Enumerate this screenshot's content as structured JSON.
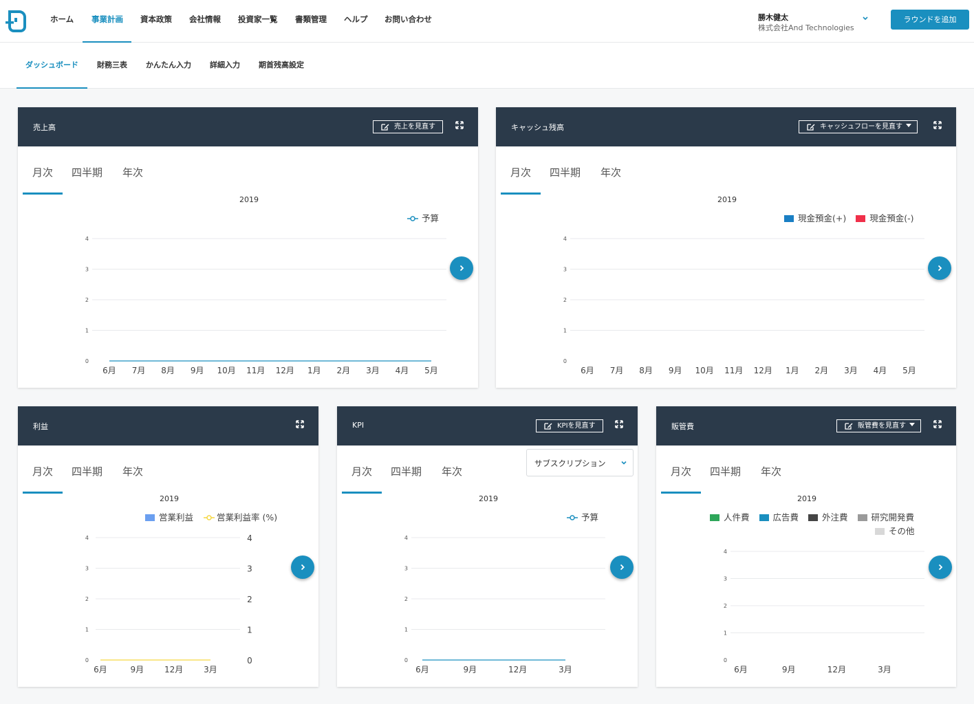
{
  "nav": {
    "items": [
      "ホーム",
      "事業計画",
      "資本政策",
      "会社情報",
      "投資家一覧",
      "書類管理",
      "ヘルプ",
      "お問い合わせ"
    ],
    "active_index": 1,
    "user_name": "勝木健太",
    "user_company": "株式会社And Technologies",
    "add_round_label": "ラウンドを追加"
  },
  "subnav": {
    "items": [
      "ダッシュボード",
      "財務三表",
      "かんたん入力",
      "詳細入力",
      "期首残高設定"
    ],
    "active_index": 0
  },
  "common": {
    "tabs": [
      "月次",
      "四半期",
      "年次"
    ],
    "year": "2019"
  },
  "cards": {
    "sales": {
      "title": "売上高",
      "revise_label": "売上を見直す"
    },
    "cash": {
      "title": "キャッシュ残高",
      "revise_label": "キャッシュフローを見直す"
    },
    "profit": {
      "title": "利益"
    },
    "kpi": {
      "title": "KPI",
      "revise_label": "KPIを見直す",
      "select_value": "サブスクリプション"
    },
    "sga": {
      "title": "販管費",
      "revise_label": "販管費を見直す"
    }
  },
  "colors": {
    "accent": "#1a8fbf",
    "header_bg": "#2b3a4a",
    "cash_plus": "#1a7fc4",
    "cash_minus": "#f0304a",
    "op_profit": "#6b9ff0",
    "op_margin": "#f5d742",
    "personnel": "#2ea65a",
    "advertising": "#1a8fbf",
    "outsourcing": "#454545",
    "rnd": "#9a9a9a",
    "other": "#d8d8d8"
  },
  "chart_data": [
    {
      "type": "line",
      "panel": "売上高",
      "title": "2019",
      "categories": [
        "6月",
        "7月",
        "8月",
        "9月",
        "10月",
        "11月",
        "12月",
        "1月",
        "2月",
        "3月",
        "4月",
        "5月"
      ],
      "series": [
        {
          "name": "予算",
          "values": [
            0,
            0,
            0,
            0,
            0,
            0,
            0,
            0,
            0,
            0,
            0,
            0
          ]
        }
      ],
      "y_ticks": [
        "0",
        "1",
        "2",
        "3",
        "4"
      ],
      "ylim": [
        0,
        4
      ],
      "grid": true,
      "legend": "top-right"
    },
    {
      "type": "bar",
      "panel": "キャッシュ残高",
      "title": "2019",
      "categories": [
        "6月",
        "7月",
        "8月",
        "9月",
        "10月",
        "11月",
        "12月",
        "1月",
        "2月",
        "3月",
        "4月",
        "5月"
      ],
      "series": [
        {
          "name": "現金預金(+)",
          "values": [
            0,
            0,
            0,
            0,
            0,
            0,
            0,
            0,
            0,
            0,
            0,
            0
          ]
        },
        {
          "name": "現金預金(-)",
          "values": [
            0,
            0,
            0,
            0,
            0,
            0,
            0,
            0,
            0,
            0,
            0,
            0
          ]
        }
      ],
      "y_ticks": [
        "0",
        "1",
        "2",
        "3",
        "4"
      ],
      "ylim": [
        0,
        4
      ],
      "grid": true,
      "legend": "top-right"
    },
    {
      "type": "bar",
      "panel": "利益",
      "title": "2019",
      "categories": [
        "6月",
        "9月",
        "12月",
        "3月"
      ],
      "series": [
        {
          "name": "営業利益",
          "values": [
            0,
            0,
            0,
            0
          ]
        },
        {
          "name": "営業利益率 (%)",
          "values": [
            0,
            0,
            0,
            0
          ]
        }
      ],
      "y_ticks": [
        "0",
        "1",
        "2",
        "3",
        "4"
      ],
      "y2_ticks": [
        "0",
        "1",
        "2",
        "3",
        "4"
      ],
      "ylim": [
        0,
        4
      ],
      "grid": true,
      "legend": "top-right"
    },
    {
      "type": "line",
      "panel": "KPI",
      "title": "2019",
      "categories": [
        "6月",
        "9月",
        "12月",
        "3月"
      ],
      "series": [
        {
          "name": "予算",
          "values": [
            0,
            0,
            0,
            0
          ]
        }
      ],
      "y_ticks": [
        "0",
        "1",
        "2",
        "3",
        "4"
      ],
      "ylim": [
        0,
        4
      ],
      "grid": true,
      "legend": "top-right"
    },
    {
      "type": "bar",
      "panel": "販管費",
      "title": "2019",
      "categories": [
        "6月",
        "9月",
        "12月",
        "3月"
      ],
      "series": [
        {
          "name": "人件費",
          "values": [
            0,
            0,
            0,
            0
          ]
        },
        {
          "name": "広告費",
          "values": [
            0,
            0,
            0,
            0
          ]
        },
        {
          "name": "外注費",
          "values": [
            0,
            0,
            0,
            0
          ]
        },
        {
          "name": "研究開発費",
          "values": [
            0,
            0,
            0,
            0
          ]
        },
        {
          "name": "その他",
          "values": [
            0,
            0,
            0,
            0
          ]
        }
      ],
      "y_ticks": [
        "0",
        "1",
        "2",
        "3",
        "4"
      ],
      "ylim": [
        0,
        4
      ],
      "grid": true,
      "legend": "top-right"
    }
  ]
}
